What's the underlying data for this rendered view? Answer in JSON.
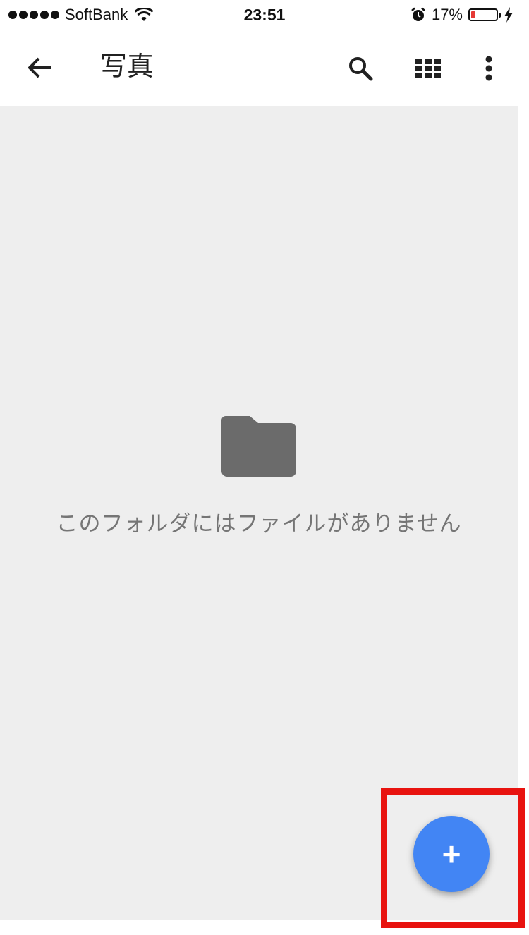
{
  "status_bar": {
    "carrier": "SoftBank",
    "time": "23:51",
    "battery_percent": "17%",
    "battery_level": 0.17,
    "icons": [
      "signal-dots-icon",
      "wifi-icon",
      "alarm-icon",
      "battery-icon",
      "charging-bolt-icon"
    ]
  },
  "app_bar": {
    "title": "写真",
    "icons": [
      "back-arrow-icon",
      "search-icon",
      "grid-view-icon",
      "more-vert-icon"
    ]
  },
  "empty_state": {
    "icon": "folder-icon",
    "message": "このフォルダにはファイルがありません"
  },
  "fab": {
    "label": "+",
    "color": "#4285f4",
    "highlight_color": "#e8130f"
  },
  "colors": {
    "content_background": "#eeeeee",
    "empty_text": "#757575",
    "folder": "#6b6b6b"
  }
}
